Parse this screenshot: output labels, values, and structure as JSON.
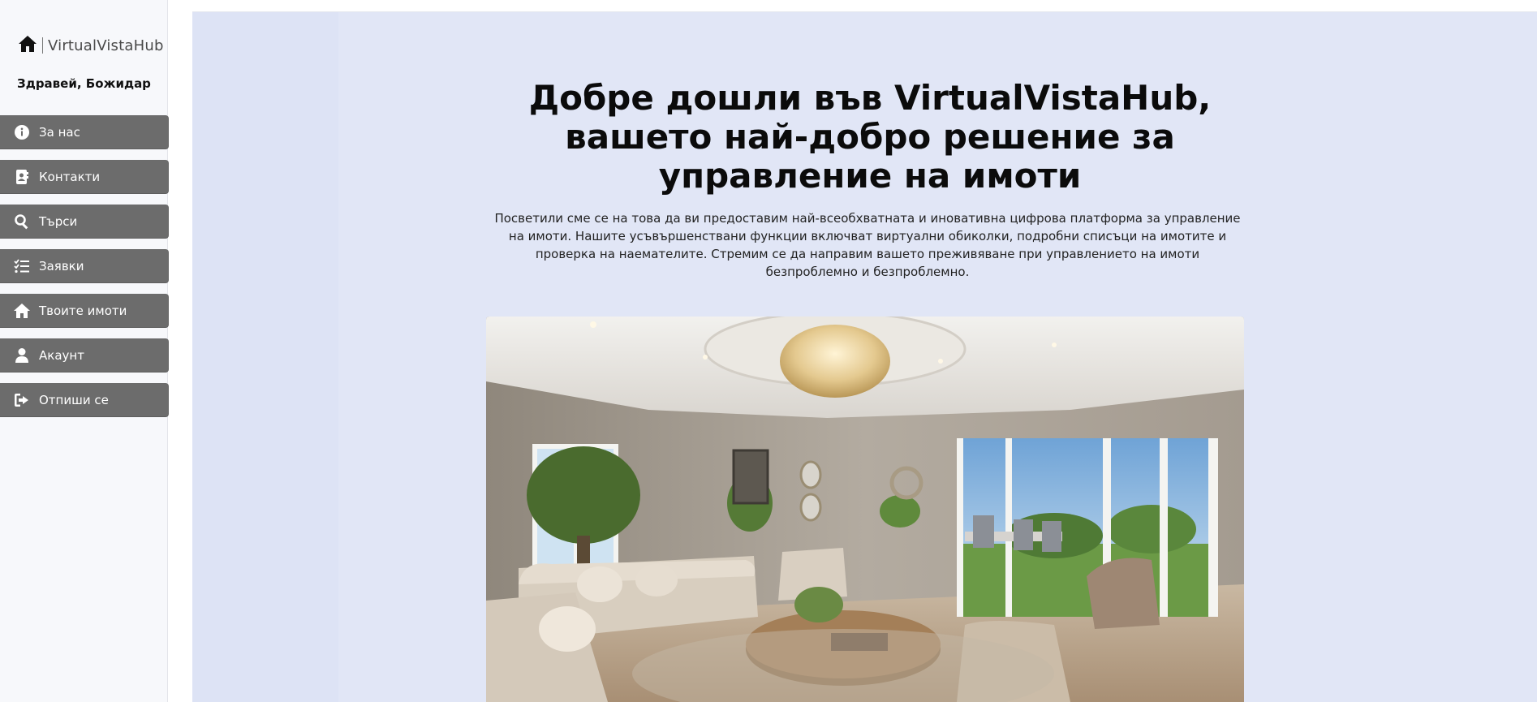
{
  "brand": {
    "name": "VirtualVistaHub",
    "logo_icon": "house-icon"
  },
  "greeting": "Здравей, Божидар",
  "nav": [
    {
      "label": "За нас",
      "icon": "info-icon"
    },
    {
      "label": "Контакти",
      "icon": "contact-book-icon"
    },
    {
      "label": "Търси",
      "icon": "search-icon"
    },
    {
      "label": "Заявки",
      "icon": "list-check-icon"
    },
    {
      "label": "Твоите имоти",
      "icon": "home-icon"
    },
    {
      "label": "Акаунт",
      "icon": "user-icon"
    },
    {
      "label": "Отпиши се",
      "icon": "sign-out-icon"
    }
  ],
  "main": {
    "title": "Добре дошли във VirtualVistaHub, вашето най-добро решение за управление на имоти",
    "description": "Посветили сме се на това да ви предоставим най-всеобхватната и иновативна цифрова платформа за управление на имоти. Нашите усъвършенствани функции включват виртуални обиколки, подробни списъци на имотите и проверка на наемателите. Стремим се да направим вашето преживяване при управлението на имоти безпроблемно и безпроблемно."
  },
  "colors": {
    "sidebar_bg": "#f7f8fb",
    "nav_button": "#6c6c6c",
    "main_bg": "#e1e6f6",
    "text": "#0b0b0b"
  }
}
